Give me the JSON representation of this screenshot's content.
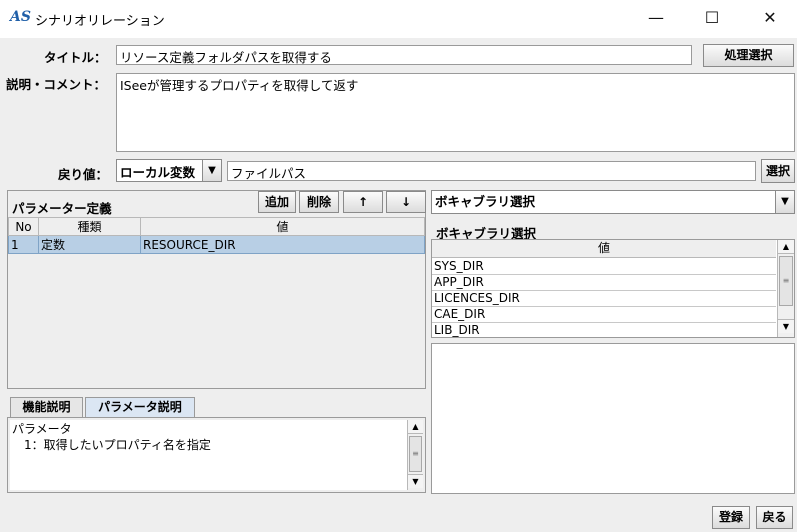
{
  "window": {
    "title": "シナリオリレーション",
    "logo": "AS",
    "minimize_glyph": "—",
    "maximize_glyph": "☐",
    "close_glyph": "✕"
  },
  "form": {
    "title_label": "タイトル：",
    "title_value": "リソース定義フォルダパスを取得する",
    "process_select_button": "処理選択",
    "desc_label": "説明・コメント：",
    "desc_value": "ISeeが管理するプロパティを取得して返す",
    "return_label": "戻り値：",
    "return_type_selected": "ローカル変数",
    "return_value": "ファイルパス",
    "select_button": "選択"
  },
  "params": {
    "header": "パラメーター定義",
    "add_button": "追加",
    "delete_button": "削除",
    "up_button": "↑",
    "down_button": "↓",
    "columns": [
      "No",
      "種類",
      "値"
    ],
    "rows": [
      {
        "no": "1",
        "kind": "定数",
        "value": "RESOURCE_DIR"
      }
    ]
  },
  "vocab": {
    "combo_selected": "ボキャブラリ選択",
    "header": "ボキャブラリ選択",
    "column": "値",
    "items": [
      "SYS_DIR",
      "APP_DIR",
      "LICENCES_DIR",
      "CAE_DIR",
      "LIB_DIR"
    ]
  },
  "help": {
    "tabs": [
      "機能説明",
      "パラメータ説明"
    ],
    "active_tab": 1,
    "line1": "パラメータ",
    "line2": "1：取得したいプロパティ名を指定"
  },
  "footer": {
    "register_button": "登録",
    "back_button": "戻る"
  }
}
